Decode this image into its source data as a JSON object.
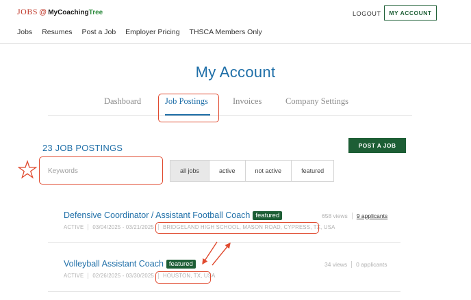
{
  "header": {
    "logo": {
      "jobs": "JOBS",
      "at": "@",
      "brand": "MyCoaching",
      "brand_tree": "Tree"
    },
    "logout_label": "LOGOUT",
    "my_account_label": "MY ACCOUNT",
    "nav": [
      "Jobs",
      "Resumes",
      "Post a Job",
      "Employer Pricing",
      "THSCA Members Only"
    ]
  },
  "page": {
    "title": "My Account",
    "tabs": [
      {
        "label": "Dashboard",
        "active": false
      },
      {
        "label": "Job Postings",
        "active": true
      },
      {
        "label": "Invoices",
        "active": false
      },
      {
        "label": "Company Settings",
        "active": false
      }
    ]
  },
  "postings": {
    "count_label": "23 JOB POSTINGS",
    "post_job_label": "POST A JOB",
    "search_placeholder": "Keywords",
    "filters": [
      {
        "label": "all jobs",
        "selected": true
      },
      {
        "label": "active",
        "selected": false
      },
      {
        "label": "not active",
        "selected": false
      },
      {
        "label": "featured",
        "selected": false
      }
    ],
    "jobs": [
      {
        "title": "Defensive Coordinator / Assistant Football Coach",
        "badge": "featured",
        "views": "658 views",
        "applicants": "9 applicants",
        "status": "ACTIVE",
        "dates": "03/04/2025 - 03/21/2025",
        "location": "BRIDGELAND HIGH SCHOOL, MASON ROAD, CYPRESS, TX, USA"
      },
      {
        "title": "Volleyball Assistant Coach",
        "badge": "featured",
        "views": "34 views",
        "applicants": "0 applicants",
        "status": "ACTIVE",
        "dates": "02/26/2025 - 03/30/2025",
        "location": "HOUSTON, TX, USA"
      }
    ]
  },
  "colors": {
    "accent_blue": "#1f6fa8",
    "brand_green": "#1d5e35",
    "annotation_red": "#e04a2f"
  }
}
